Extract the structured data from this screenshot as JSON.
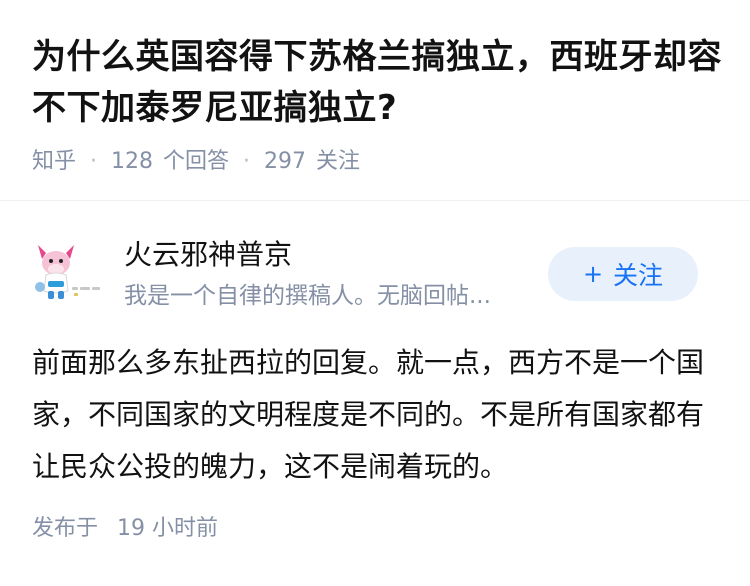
{
  "question": {
    "title": "为什么英国容得下苏格兰搞独立，西班牙却容不下加泰罗尼亚搞独立?",
    "source": "知乎",
    "answer_count": "128",
    "answer_label": "个回答",
    "follower_count": "297",
    "follower_label": "关注"
  },
  "answer": {
    "author": {
      "name": "火云邪神普京",
      "bio": "我是一个自律的撰稿人。无脑回帖...",
      "avatar": "cartoon-avatar-icon"
    },
    "follow_button": {
      "plus": "+",
      "label": "关注"
    },
    "content": "前面那么多东扯西拉的回复。就一点，西方不是一个国家，不同国家的文明程度是不同的。不是所有国家都有让民众公投的魄力，这不是闹着玩的。",
    "time_prefix": "发布于",
    "time_value": "19",
    "time_unit": "小时前"
  },
  "colors": {
    "title": "#121212",
    "meta": "#8590a6",
    "accent": "#1772f6",
    "button_bg": "#e8f0fc"
  }
}
